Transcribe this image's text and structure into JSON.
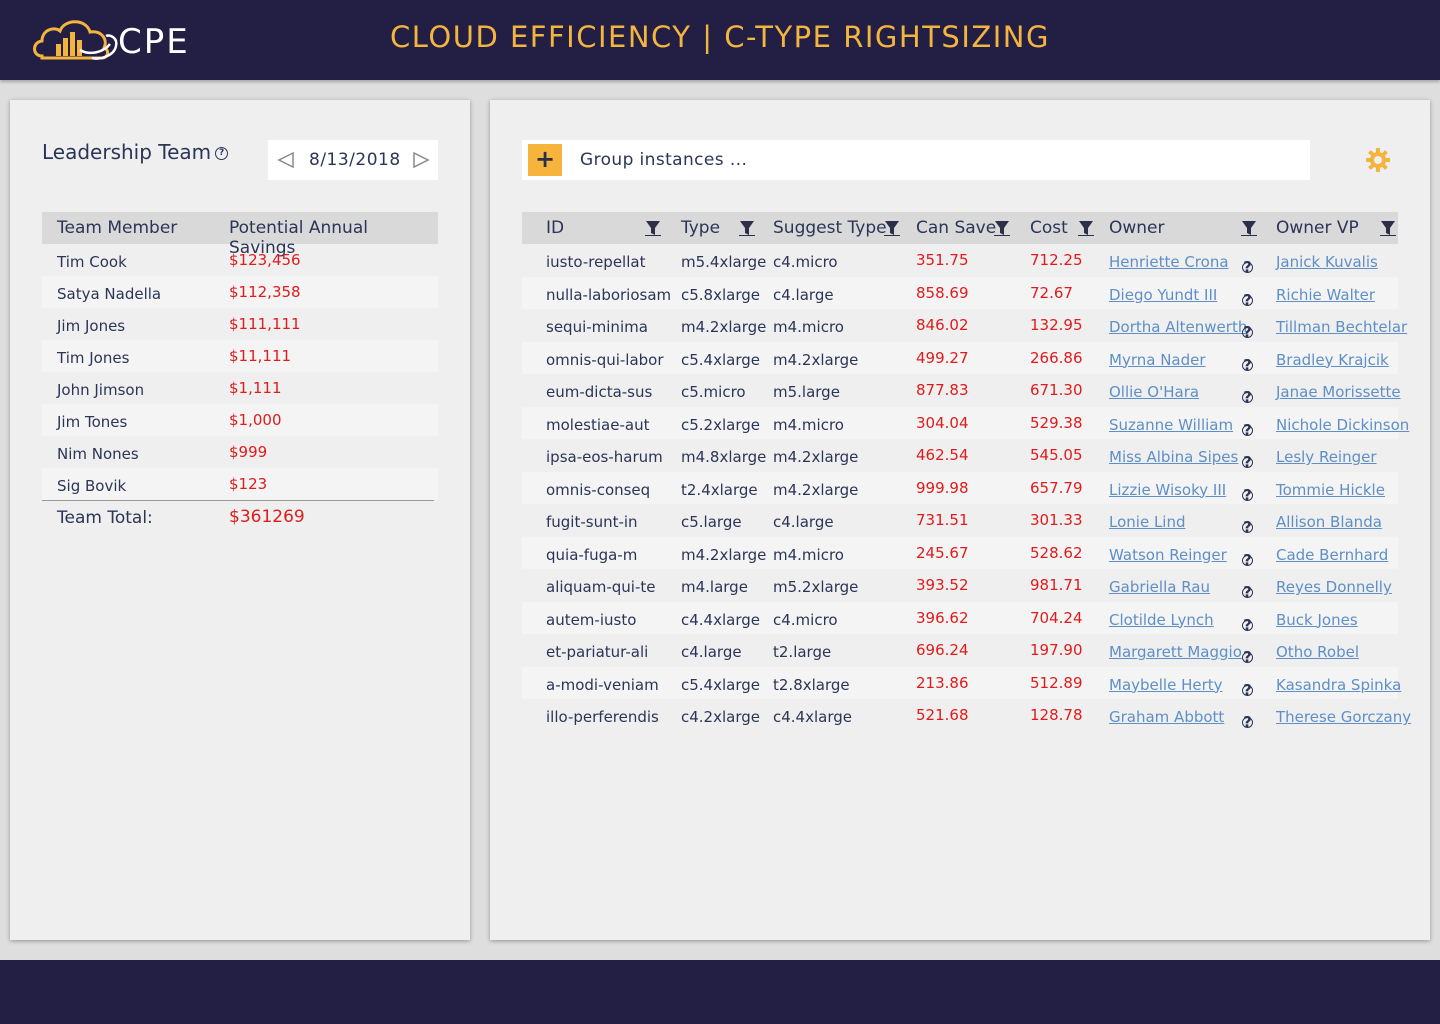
{
  "header": {
    "logo_text": "CPE",
    "title": "CLOUD EFFICIENCY | C-TYPE RIGHTSIZING"
  },
  "colors": {
    "nav_bg": "#221e44",
    "accent": "#f4b53f",
    "money": "#e01b1b",
    "link": "#5e8fc6"
  },
  "leadership": {
    "title": "Leadership Team",
    "date": "8/13/2018",
    "col_member": "Team Member",
    "col_savings": "Potential Annual Savings",
    "rows": [
      {
        "name": "Tim Cook",
        "savings": "$123,456"
      },
      {
        "name": "Satya Nadella",
        "savings": "$112,358"
      },
      {
        "name": "Jim Jones",
        "savings": "$111,111"
      },
      {
        "name": "Tim Jones",
        "savings": "$11,111"
      },
      {
        "name": "John Jimson",
        "savings": "$1,111"
      },
      {
        "name": "Jim Tones",
        "savings": "$1,000"
      },
      {
        "name": "Nim Nones",
        "savings": "$999"
      },
      {
        "name": "Sig Bovik",
        "savings": "$123"
      }
    ],
    "total_label": "Team Total:",
    "total_value": "$361269"
  },
  "instances": {
    "group_placeholder": "Group instances ...",
    "add_label": "+",
    "columns": [
      "ID",
      "Type",
      "Suggest Type",
      "Can Save",
      "Cost",
      "Owner",
      "Owner VP"
    ],
    "rows": [
      {
        "id": "iusto-repellat",
        "type": "m5.4xlarge",
        "suggest": "c4.micro",
        "save": "351.75",
        "cost": "712.25",
        "owner": "Henriette Crona",
        "vp": "Janick Kuvalis"
      },
      {
        "id": "nulla-laboriosam",
        "type": "c5.8xlarge",
        "suggest": "c4.large",
        "save": "858.69",
        "cost": "72.67",
        "owner": "Diego Yundt III",
        "vp": "Richie Walter"
      },
      {
        "id": "sequi-minima",
        "type": "m4.2xlarge",
        "suggest": "m4.micro",
        "save": "846.02",
        "cost": "132.95",
        "owner": "Dortha Altenwerth",
        "vp": "Tillman Bechtelar"
      },
      {
        "id": "omnis-qui-labor",
        "type": "c5.4xlarge",
        "suggest": "m4.2xlarge",
        "save": "499.27",
        "cost": "266.86",
        "owner": "Myrna Nader",
        "vp": "Bradley Krajcik"
      },
      {
        "id": "eum-dicta-sus",
        "type": "c5.micro",
        "suggest": "m5.large",
        "save": "877.83",
        "cost": "671.30",
        "owner": "Ollie O'Hara",
        "vp": "Janae Morissette"
      },
      {
        "id": "molestiae-aut",
        "type": "c5.2xlarge",
        "suggest": "m4.micro",
        "save": "304.04",
        "cost": "529.38",
        "owner": "Suzanne William",
        "vp": "Nichole Dickinson"
      },
      {
        "id": "ipsa-eos-harum",
        "type": "m4.8xlarge",
        "suggest": "m4.2xlarge",
        "save": "462.54",
        "cost": "545.05",
        "owner": "Miss Albina Sipes",
        "vp": "Lesly Reinger"
      },
      {
        "id": "omnis-conseq",
        "type": "t2.4xlarge",
        "suggest": "m4.2xlarge",
        "save": "999.98",
        "cost": "657.79",
        "owner": "Lizzie Wisoky III",
        "vp": "Tommie Hickle"
      },
      {
        "id": "fugit-sunt-in",
        "type": "c5.large",
        "suggest": "c4.large",
        "save": "731.51",
        "cost": "301.33",
        "owner": "Lonie Lind",
        "vp": "Allison Blanda"
      },
      {
        "id": "quia-fuga-m",
        "type": "m4.2xlarge",
        "suggest": "m4.micro",
        "save": "245.67",
        "cost": "528.62",
        "owner": "Watson Reinger",
        "vp": "Cade Bernhard"
      },
      {
        "id": "aliquam-qui-te",
        "type": "m4.large",
        "suggest": "m5.2xlarge",
        "save": "393.52",
        "cost": "981.71",
        "owner": "Gabriella Rau",
        "vp": "Reyes Donnelly"
      },
      {
        "id": "autem-iusto",
        "type": "c4.4xlarge",
        "suggest": "c4.micro",
        "save": "396.62",
        "cost": "704.24",
        "owner": "Clotilde Lynch",
        "vp": "Buck Jones"
      },
      {
        "id": "et-pariatur-ali",
        "type": "c4.large",
        "suggest": "t2.large",
        "save": "696.24",
        "cost": "197.90",
        "owner": "Margarett Maggio",
        "vp": "Otho Robel"
      },
      {
        "id": "a-modi-veniam",
        "type": "c5.4xlarge",
        "suggest": "t2.8xlarge",
        "save": "213.86",
        "cost": "512.89",
        "owner": "Maybelle Herty",
        "vp": "Kasandra Spinka"
      },
      {
        "id": "illo-perferendis",
        "type": "c4.2xlarge",
        "suggest": "c4.4xlarge",
        "save": "521.68",
        "cost": "128.78",
        "owner": "Graham Abbott",
        "vp": "Therese Gorczany"
      }
    ]
  }
}
